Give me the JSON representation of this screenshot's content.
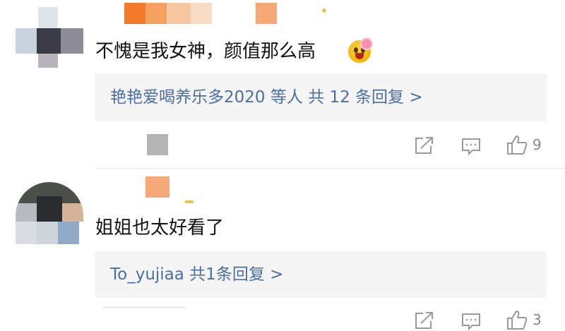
{
  "comments": [
    {
      "text": "不愧是我女神，颜值那么高",
      "emoji": "star-struck-flower-emoji",
      "replies": {
        "summary": "艳艳爱喝养乐多2020 等人 共 12 条回复 >"
      },
      "actions": {
        "like_count": "9"
      }
    },
    {
      "text": "姐姐也太好看了",
      "replies": {
        "summary": "To_yujiaa 共1条回复 >"
      },
      "actions": {
        "like_count": "3"
      }
    }
  ],
  "icons": {
    "share": "share-icon",
    "comment": "comment-icon",
    "like": "thumbs-up-icon"
  },
  "colors": {
    "link": "#4a6fa5",
    "reply_box_bg": "#f5f5f5",
    "icon_gray": "#9a9a9a"
  }
}
